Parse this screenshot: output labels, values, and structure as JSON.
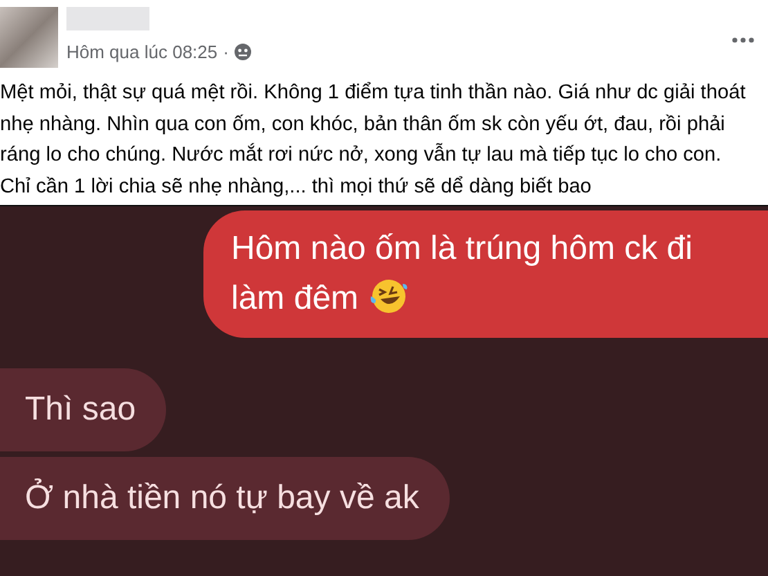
{
  "post": {
    "timestamp": "Hôm qua lúc 08:25",
    "separator": "·",
    "body": "Mệt mỏi, thật sự quá mệt rồi. Không 1 điểm tựa tinh thần nào. Giá như dc giải thoát nhẹ nhàng. Nhìn qua con ốm, con khóc, bản thân ốm sk còn yếu ớt, đau, rồi phải ráng lo cho chúng. Nước mắt rơi nức nở, xong vẫn tự lau mà tiếp tục lo cho con. Chỉ cần 1 lời chia sẽ nhẹ nhàng,... thì mọi thứ sẽ dể dàng biết bao"
  },
  "chat": {
    "messages": [
      {
        "kind": "sent",
        "text": "Hôm nào ốm là trúng hôm ck đi làm đêm",
        "emoji": true
      },
      {
        "kind": "received",
        "text": "Thì sao",
        "emoji": false
      },
      {
        "kind": "received",
        "text": "Ở nhà tiền nó tự bay về ak",
        "emoji": false
      }
    ]
  }
}
